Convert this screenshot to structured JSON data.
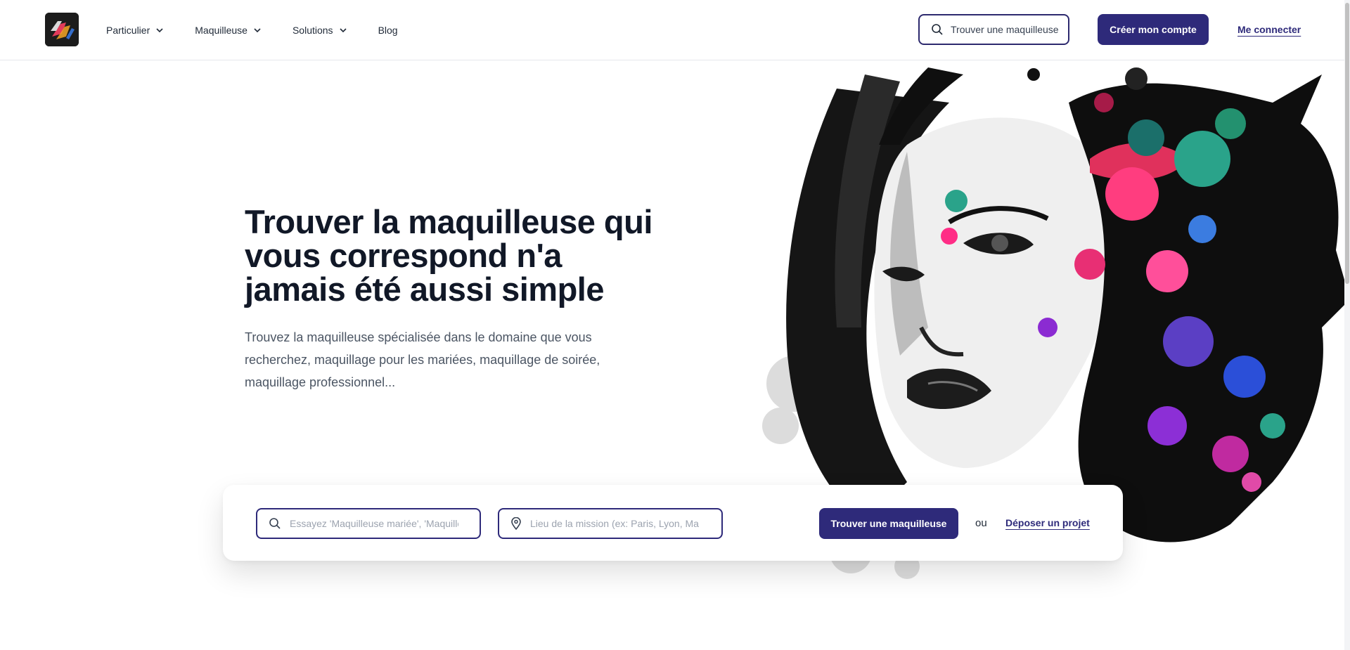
{
  "header": {
    "nav": [
      {
        "label": "Particulier",
        "has_dropdown": true
      },
      {
        "label": "Maquilleuse",
        "has_dropdown": true
      },
      {
        "label": "Solutions",
        "has_dropdown": true
      },
      {
        "label": "Blog",
        "has_dropdown": false
      }
    ],
    "search_label": "Trouver une maquilleuse",
    "create_account_label": "Créer mon compte",
    "login_label": "Me connecter"
  },
  "hero": {
    "title_lines": [
      "Trouver la maquilleuse qui",
      "vous correspond n'a",
      "jamais été aussi simple"
    ],
    "subtitle_lines": [
      "Trouvez la maquilleuse spécialisée dans le domaine que vous",
      "recherchez, maquillage pour les mariées, maquillage de soirée,",
      "maquillage professionnel..."
    ]
  },
  "search_panel": {
    "query_placeholder": "Essayez 'Maquilleuse mariée', 'Maquilleuse pro'",
    "location_placeholder": "Lieu de la mission (ex: Paris, Lyon, Marseille)",
    "find_button_label": "Trouver une maquilleuse",
    "or_label": "ou",
    "post_project_label": "Déposer un projet"
  },
  "colors": {
    "brand": "#2e2a7a",
    "heading": "#111827",
    "body_text": "#4b5563"
  },
  "icons": {
    "search": "search-icon",
    "location": "map-pin-icon",
    "dropdown": "chevron-down-icon"
  }
}
